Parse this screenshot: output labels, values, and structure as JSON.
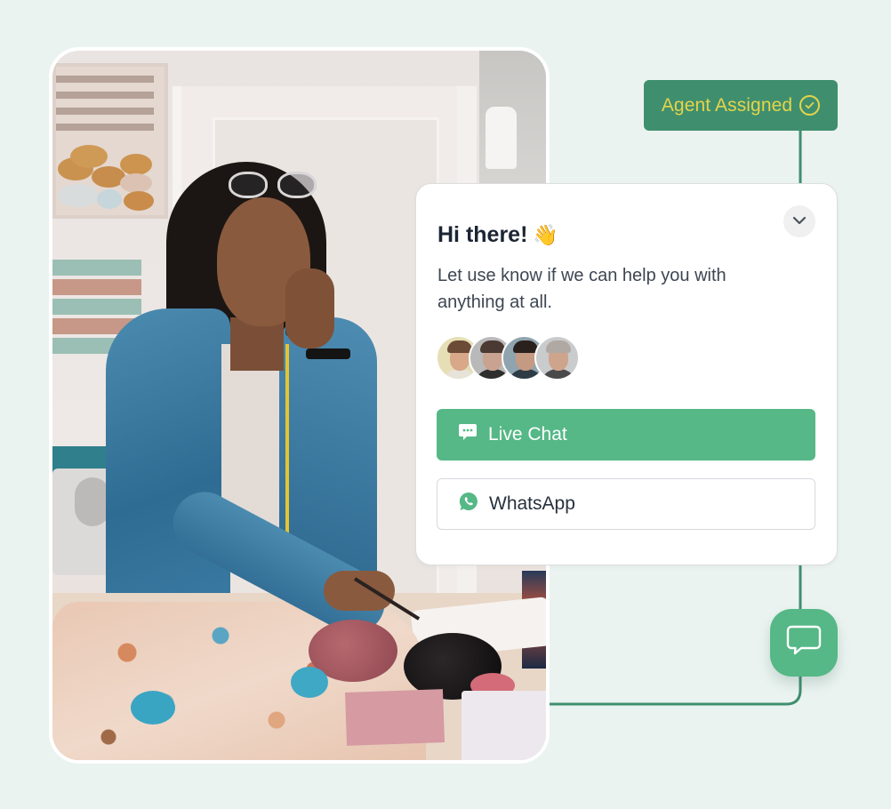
{
  "photo": {
    "description": "Woman on the phone at a sewing table with fabric and yarn"
  },
  "agent_badge": {
    "label": "Agent Assigned",
    "icon": "check-circle-icon"
  },
  "chat_widget": {
    "title": "Hi there!",
    "title_emoji": "👋",
    "subtitle": "Let use know if we can help you with anything at all.",
    "collapse_icon": "chevron-down-icon",
    "agents": [
      {
        "name": "agent-1"
      },
      {
        "name": "agent-2"
      },
      {
        "name": "agent-3"
      },
      {
        "name": "agent-4"
      }
    ],
    "buttons": {
      "live_chat": {
        "label": "Live Chat",
        "icon": "chat-dots-icon"
      },
      "whatsapp": {
        "label": "WhatsApp",
        "icon": "whatsapp-icon"
      }
    }
  },
  "launcher": {
    "icon": "chat-bubble-icon"
  },
  "colors": {
    "background": "#eaf3f0",
    "badge_bg": "#3f8f6e",
    "badge_text": "#e6d44a",
    "primary_green": "#55b886",
    "connector": "#3f8f6e",
    "title_text": "#1b2533",
    "body_text": "#3d4652"
  }
}
